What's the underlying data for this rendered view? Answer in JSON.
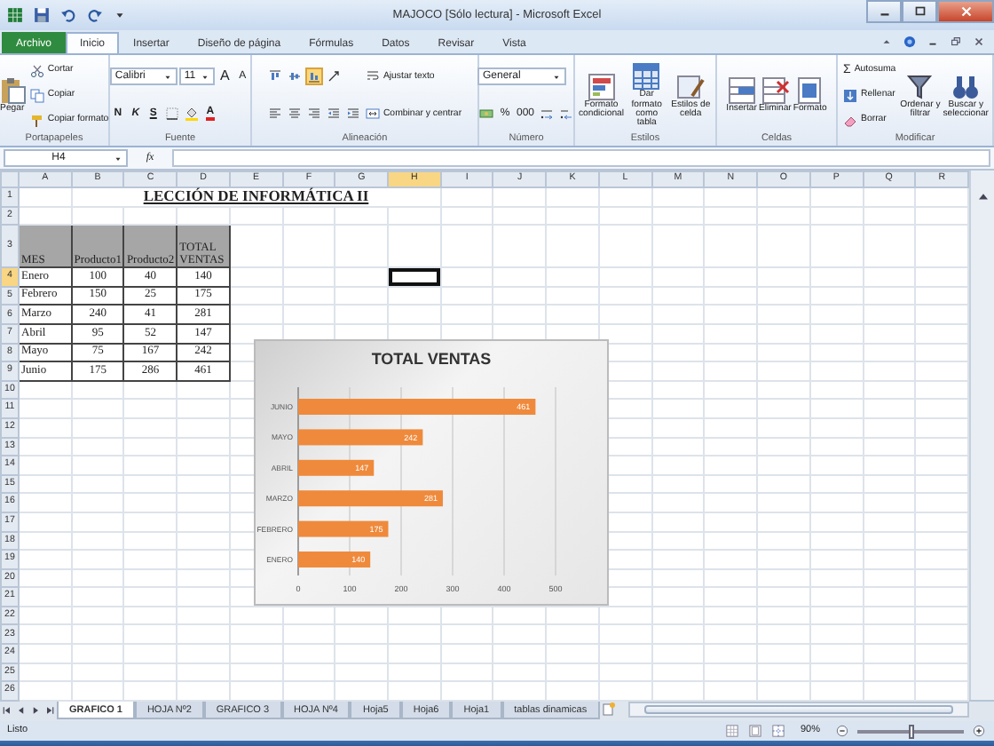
{
  "window": {
    "title": "MAJOCO [Sólo lectura] - Microsoft Excel"
  },
  "ribbon_tabs": [
    {
      "label": "Archivo",
      "kind": "file",
      "selected": false
    },
    {
      "label": "Inicio",
      "kind": "tab",
      "selected": true
    },
    {
      "label": "Insertar",
      "kind": "tab",
      "selected": false
    },
    {
      "label": "Diseño de página",
      "kind": "tab",
      "selected": false
    },
    {
      "label": "Fórmulas",
      "kind": "tab",
      "selected": false
    },
    {
      "label": "Datos",
      "kind": "tab",
      "selected": false
    },
    {
      "label": "Revisar",
      "kind": "tab",
      "selected": false
    },
    {
      "label": "Vista",
      "kind": "tab",
      "selected": false
    }
  ],
  "ribbon_groups": [
    {
      "label": "Portapapeles",
      "columns": [
        [
          [
            {
              "kind": "large",
              "label": "Pegar"
            }
          ]
        ],
        [
          [
            {
              "kind": "button",
              "label": "Cortar"
            }
          ],
          [
            {
              "kind": "button",
              "label": "Copiar"
            }
          ],
          [
            {
              "kind": "button",
              "label": "Copiar formato"
            }
          ]
        ]
      ]
    },
    {
      "label": "Fuente",
      "columns": [
        [
          [
            {
              "kind": "field",
              "label": "Calibri"
            },
            {
              "kind": "field",
              "label": "11"
            },
            {
              "kind": "glyph",
              "label": "A"
            },
            {
              "kind": "glyph",
              "label": "A"
            }
          ],
          [
            {
              "kind": "glyph",
              "label": "N"
            },
            {
              "kind": "glyph",
              "label": "K"
            },
            {
              "kind": "glyph",
              "label": "S"
            },
            {
              "kind": "icon"
            },
            {
              "kind": "icon"
            },
            {
              "kind": "glyph",
              "label": "A"
            }
          ]
        ]
      ]
    },
    {
      "label": "Alineación",
      "columns": [
        [
          [
            {
              "kind": "icon",
              "selected": false
            },
            {
              "kind": "icon",
              "selected": false
            },
            {
              "kind": "icon",
              "selected": true
            },
            {
              "kind": "icon"
            }
          ],
          [
            {
              "kind": "icon"
            },
            {
              "kind": "icon"
            },
            {
              "kind": "icon"
            },
            {
              "kind": "icon"
            },
            {
              "kind": "icon"
            }
          ]
        ],
        [
          [
            {
              "kind": "button",
              "label": "Ajustar texto"
            }
          ],
          [
            {
              "kind": "button",
              "label": "Combinar y centrar"
            }
          ]
        ]
      ]
    },
    {
      "label": "Número",
      "columns": [
        [
          [
            {
              "kind": "field",
              "label": "General"
            }
          ],
          [
            {
              "kind": "icon"
            },
            {
              "kind": "glyph",
              "label": "%"
            },
            {
              "kind": "glyph",
              "label": "000"
            },
            {
              "kind": "icon"
            },
            {
              "kind": "icon"
            }
          ]
        ]
      ]
    },
    {
      "label": "Estilos",
      "columns": [
        [
          [
            {
              "kind": "large",
              "label": "Formato condicional"
            }
          ]
        ],
        [
          [
            {
              "kind": "large",
              "label": "Dar formato como tabla"
            }
          ]
        ],
        [
          [
            {
              "kind": "large",
              "label": "Estilos de celda"
            }
          ]
        ]
      ]
    },
    {
      "label": "Celdas",
      "columns": [
        [
          [
            {
              "kind": "large",
              "label": "Insertar"
            }
          ]
        ],
        [
          [
            {
              "kind": "large",
              "label": "Eliminar"
            }
          ]
        ],
        [
          [
            {
              "kind": "large",
              "label": "Formato"
            }
          ]
        ]
      ]
    },
    {
      "label": "Modificar",
      "columns": [
        [
          [
            {
              "kind": "button",
              "label": "Autosuma",
              "symbol": "Σ"
            }
          ],
          [
            {
              "kind": "button",
              "label": "Rellenar"
            }
          ],
          [
            {
              "kind": "button",
              "label": "Borrar"
            }
          ]
        ],
        [
          [
            {
              "kind": "large",
              "label": "Ordenar y filtrar"
            }
          ]
        ],
        [
          [
            {
              "kind": "large",
              "label": "Buscar y seleccionar"
            }
          ]
        ]
      ]
    }
  ],
  "formula_bar": {
    "name_box": "H4",
    "function_label": "fx"
  },
  "sheet": {
    "columns": [
      {
        "label": "A",
        "selected": false
      },
      {
        "label": "B",
        "selected": false
      },
      {
        "label": "C",
        "selected": false
      },
      {
        "label": "D",
        "selected": false
      },
      {
        "label": "E",
        "selected": false
      },
      {
        "label": "F",
        "selected": false
      },
      {
        "label": "G",
        "selected": false
      },
      {
        "label": "H",
        "selected": true
      },
      {
        "label": "I",
        "selected": false
      },
      {
        "label": "J",
        "selected": false
      },
      {
        "label": "K",
        "selected": false
      },
      {
        "label": "L",
        "selected": false
      },
      {
        "label": "M",
        "selected": false
      },
      {
        "label": "N",
        "selected": false
      },
      {
        "label": "O",
        "selected": false
      },
      {
        "label": "P",
        "selected": false
      },
      {
        "label": "Q",
        "selected": false
      },
      {
        "label": "R",
        "selected": false
      }
    ],
    "rows": [
      {
        "label": "1",
        "selected": false,
        "title": "LECCIÓN DE INFORMÁTICA II"
      },
      {
        "label": "2",
        "selected": false
      },
      {
        "label": "3",
        "selected": false,
        "kind": "header",
        "cells": [
          "MES",
          "Producto1",
          "Producto2",
          "TOTAL VENTAS"
        ]
      },
      {
        "label": "4",
        "selected": true,
        "kind": "data",
        "cells": [
          "Enero",
          "100",
          "40",
          "140"
        ]
      },
      {
        "label": "5",
        "selected": false,
        "kind": "data",
        "cells": [
          "Febrero",
          "150",
          "25",
          "175"
        ]
      },
      {
        "label": "6",
        "selected": false,
        "kind": "data",
        "cells": [
          "Marzo",
          "240",
          "41",
          "281"
        ]
      },
      {
        "label": "7",
        "selected": false,
        "kind": "data",
        "cells": [
          "Abril",
          "95",
          "52",
          "147"
        ]
      },
      {
        "label": "8",
        "selected": false,
        "kind": "data",
        "cells": [
          "Mayo",
          "75",
          "167",
          "242"
        ]
      },
      {
        "label": "9",
        "selected": false,
        "kind": "data",
        "cells": [
          "Junio",
          "175",
          "286",
          "461"
        ]
      },
      {
        "label": "10",
        "selected": false
      },
      {
        "label": "11",
        "selected": false
      },
      {
        "label": "12",
        "selected": false
      },
      {
        "label": "13",
        "selected": false
      },
      {
        "label": "14",
        "selected": false
      },
      {
        "label": "15",
        "selected": false
      },
      {
        "label": "16",
        "selected": false
      },
      {
        "label": "17",
        "selected": false
      },
      {
        "label": "18",
        "selected": false
      },
      {
        "label": "19",
        "selected": false
      },
      {
        "label": "20",
        "selected": false
      },
      {
        "label": "21",
        "selected": false
      },
      {
        "label": "22",
        "selected": false
      },
      {
        "label": "23",
        "selected": false
      },
      {
        "label": "24",
        "selected": false
      },
      {
        "label": "25",
        "selected": false
      },
      {
        "label": "26",
        "selected": false
      }
    ],
    "chart": {
      "chart_data": {
        "type": "bar",
        "orientation": "horizontal",
        "title": "TOTAL VENTAS",
        "categories": [
          "JUNIO",
          "MAYO",
          "ABRIL",
          "MARZO",
          "FEBRERO",
          "ENERO"
        ],
        "series": [
          {
            "color": "#ef8a3c",
            "values": [
              461,
              242,
              147,
              281,
              175,
              140
            ]
          }
        ],
        "xlim": [
          0,
          500
        ],
        "xticks": [
          0,
          100,
          200,
          300,
          400,
          500
        ],
        "grid": true,
        "data_labels": true
      }
    }
  },
  "sheet_tabs": [
    {
      "label": "GRAFICO 1",
      "selected": true
    },
    {
      "label": "HOJA Nº2",
      "selected": false
    },
    {
      "label": "GRAFICO 3",
      "selected": false
    },
    {
      "label": "HOJA Nº4",
      "selected": false
    },
    {
      "label": "Hoja5",
      "selected": false
    },
    {
      "label": "Hoja6",
      "selected": false
    },
    {
      "label": "Hoja1",
      "selected": false
    },
    {
      "label": "tablas dinamicas",
      "selected": false
    }
  ],
  "status_bar": {
    "text": "Listo",
    "zoom": "90%",
    "zoom_slider": {
      "level": 0.5
    }
  }
}
